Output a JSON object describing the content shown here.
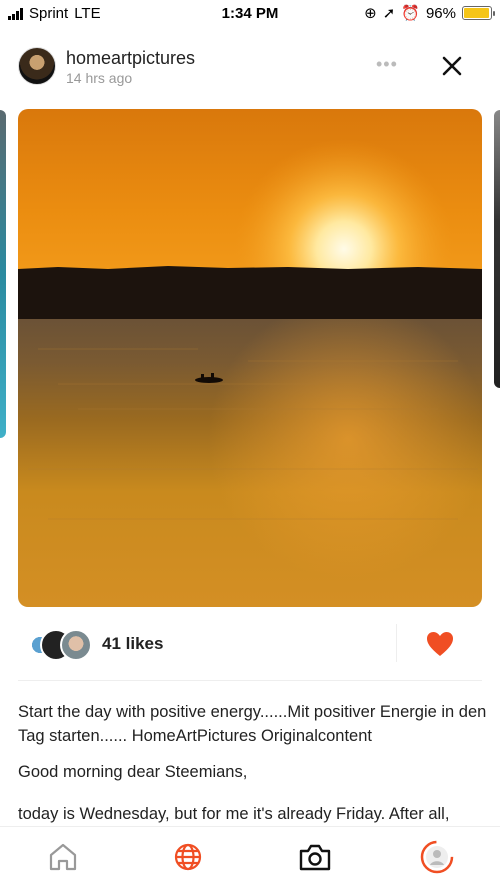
{
  "status_bar": {
    "carrier": "Sprint",
    "network": "LTE",
    "time": "1:34 PM",
    "battery": "96%",
    "battery_level": 0.96
  },
  "post": {
    "username": "homeartpictures",
    "time_ago": "14 hrs ago",
    "more_icon": "more-icon",
    "close_icon": "close-icon"
  },
  "likes": {
    "text": "41 likes",
    "heart_color": "#f04e23"
  },
  "caption": {
    "line1": "Start the day with positive energy......Mit positiver Energie in den Tag starten...... HomeArtPictures Originalcontent",
    "line2": "Good morning dear Steemians,",
    "line3": "today is Wednesday, but for me it's already Friday. After all,"
  },
  "tab_bar": {
    "accent": "#f04e23",
    "items": [
      "home-icon",
      "globe-icon",
      "camera-icon",
      "profile-icon"
    ]
  }
}
